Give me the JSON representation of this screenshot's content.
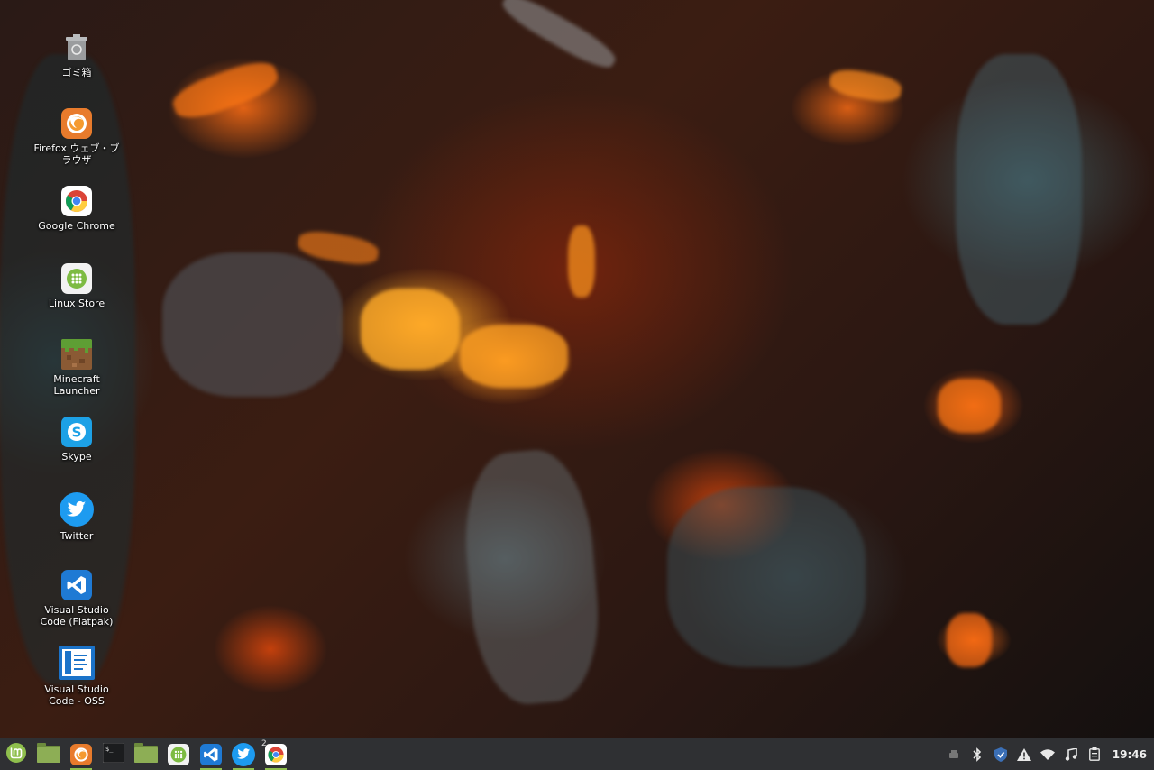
{
  "desktop": {
    "icons": [
      {
        "label": "ゴミ箱",
        "icon": "trash-icon"
      },
      {
        "label": "Firefox ウェブ・ブラウザ",
        "icon": "firefox-icon"
      },
      {
        "label": "Google Chrome",
        "icon": "chrome-icon"
      },
      {
        "label": "Linux Store",
        "icon": "linux-store-icon"
      },
      {
        "label": "Minecraft Launcher",
        "icon": "minecraft-icon"
      },
      {
        "label": "Skype",
        "icon": "skype-icon"
      },
      {
        "label": "Twitter",
        "icon": "twitter-icon"
      },
      {
        "label": "Visual Studio Code (Flatpak)",
        "icon": "vscode-icon"
      },
      {
        "label": "Visual Studio Code - OSS",
        "icon": "vscode-oss-icon"
      }
    ]
  },
  "taskbar": {
    "items": [
      {
        "name": "mint-menu",
        "icon": "linux-mint-logo-icon"
      },
      {
        "name": "show-desktop",
        "icon": "desktop-folder-icon"
      },
      {
        "name": "firefox",
        "icon": "firefox-icon"
      },
      {
        "name": "terminal",
        "icon": "terminal-icon"
      },
      {
        "name": "files",
        "icon": "folder-icon"
      },
      {
        "name": "linux-store",
        "icon": "linux-store-icon"
      },
      {
        "name": "vscode",
        "icon": "vscode-icon"
      },
      {
        "name": "twitter",
        "icon": "twitter-icon"
      },
      {
        "name": "chrome",
        "icon": "chrome-icon",
        "window_count": "2"
      }
    ],
    "tray": [
      "usb-icon",
      "bluetooth-icon",
      "shield-icon",
      "warning-icon",
      "wifi-icon",
      "music-icon",
      "clipboard-icon"
    ],
    "clock": "19:46"
  },
  "colors": {
    "taskbar_bg": "#2f3033",
    "active_indicator": "#8fbf4d",
    "mint_green": "#8fbf4d"
  }
}
